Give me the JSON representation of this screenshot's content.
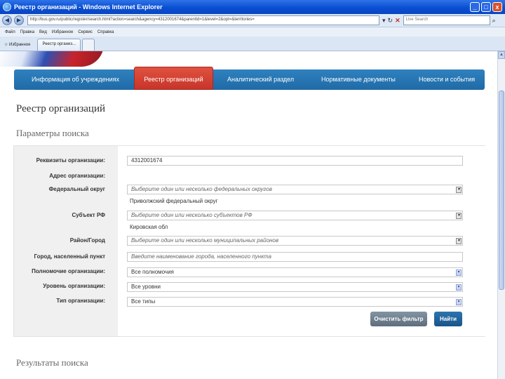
{
  "window": {
    "title": "Реестр организаций - Windows Internet Explorer",
    "controls": [
      "_",
      "□",
      "x"
    ]
  },
  "browser": {
    "address": "http://bus.gov.ru/public/register/search.html?action=search&agency=4312001674&parentId=1&level=2&opt=&territories=",
    "search_placeholder": "Live Search",
    "menu": [
      "Файл",
      "Правка",
      "Вид",
      "Избранное",
      "Сервис",
      "Справка"
    ],
    "favorites_label": "Избранное",
    "tab_label": "Реестр организ..."
  },
  "nav": {
    "items": [
      "Информация об учреждениях",
      "Реестр организаций",
      "Аналитический раздел",
      "Нормативные документы",
      "Новости и события"
    ],
    "active_index": 1
  },
  "page": {
    "title": "Реестр организаций",
    "params_title": "Параметры поиска",
    "results_title": "Результаты поиска"
  },
  "form": {
    "requisites_label": "Реквизиты организации:",
    "requisites_value": "4312001674",
    "address_label": "Адрес организации:",
    "federal_district_label": "Федеральный округ",
    "federal_district_placeholder": "Выберите один или несколько федеральных округов",
    "federal_district_selected": "Приволжский федеральный округ",
    "subject_label": "Субъект РФ",
    "subject_placeholder": "Выберите один или несколько субъектов РФ",
    "subject_selected": "Кировская обл",
    "district_label": "Район/Город",
    "district_placeholder": "Выберите один или несколько муниципальных районов",
    "city_label": "Город, населенный пункт",
    "city_placeholder": "Введите наименование города, населенного пункта",
    "authority_label": "Полномочие организации:",
    "authority_value": "Все полномочия",
    "level_label": "Уровень организации:",
    "level_value": "Все уровни",
    "type_label": "Тип организации:",
    "type_value": "Все типы",
    "clear_button": "Очистить фильтр",
    "find_button": "Найти"
  }
}
